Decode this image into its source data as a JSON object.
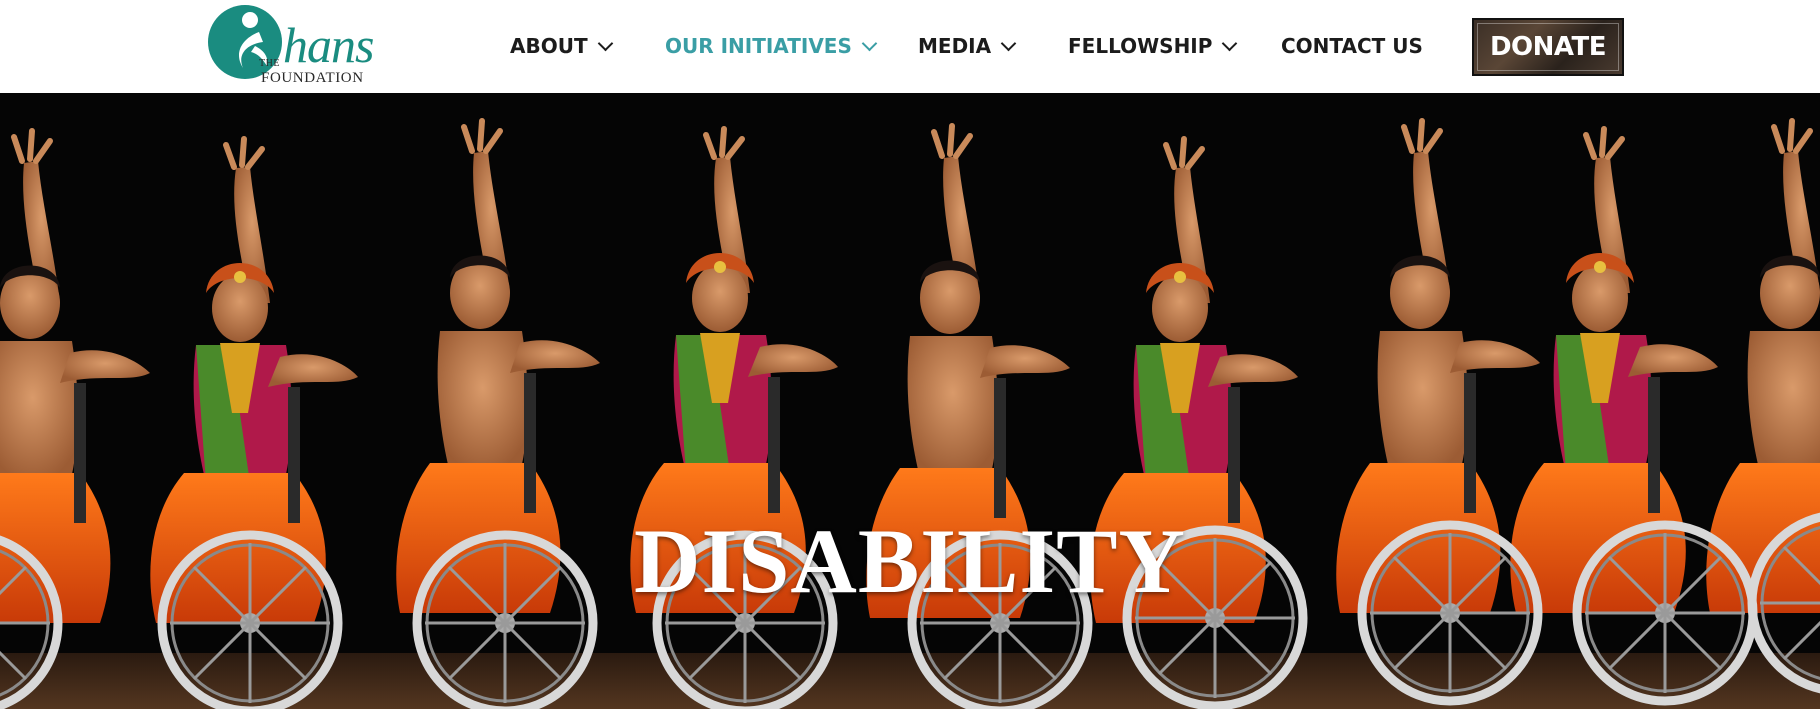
{
  "brand": {
    "logo_the": "THE",
    "logo_hans": "hans",
    "logo_foundation": "FOUNDATION",
    "color_teal": "#1a8c80"
  },
  "nav": {
    "about": "ABOUT",
    "initiatives": "OUR INITIATIVES",
    "media": "MEDIA",
    "fellowship": "FELLOWSHIP",
    "contact": "CONTACT US",
    "donate": "DONATE",
    "active_color": "#3a9ea5"
  },
  "hero": {
    "title": "DISABILITY"
  }
}
